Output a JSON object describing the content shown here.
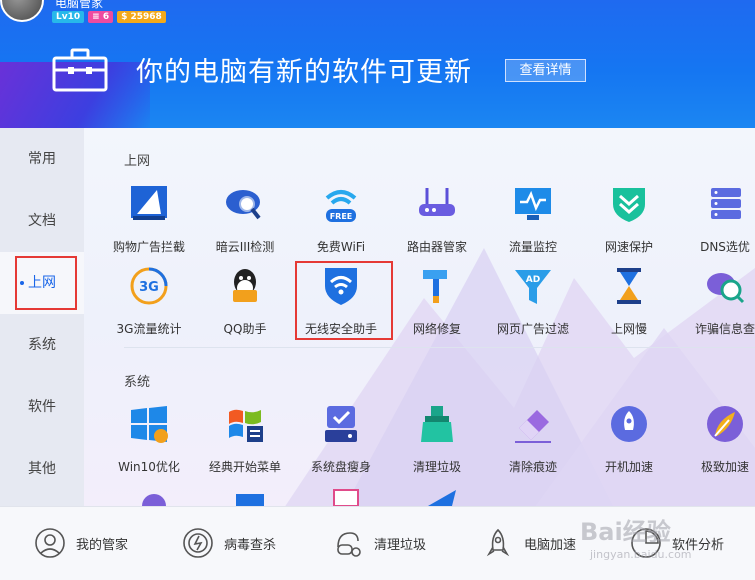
{
  "header": {
    "username": "电脑管家",
    "badges": {
      "level": "Lv10",
      "vip": "6",
      "coins": "25968"
    },
    "update_title": "你的电脑有新的软件可更新",
    "detail_button": "查看详情"
  },
  "sidebar": {
    "items": [
      {
        "label": "常用"
      },
      {
        "label": "文档"
      },
      {
        "label": "上网"
      },
      {
        "label": "系统"
      },
      {
        "label": "软件"
      },
      {
        "label": "其他"
      }
    ],
    "active": "上网"
  },
  "sections": {
    "internet": {
      "title": "上网",
      "row1": [
        {
          "label": "购物广告拦截",
          "icon": "ad-block-icon"
        },
        {
          "label": "暗云III检测",
          "icon": "cloud-scan-icon"
        },
        {
          "label": "免费WiFi",
          "icon": "free-wifi-icon",
          "icon_text": "FREE"
        },
        {
          "label": "路由器管家",
          "icon": "router-icon"
        },
        {
          "label": "流量监控",
          "icon": "traffic-monitor-icon"
        },
        {
          "label": "网速保护",
          "icon": "speed-protect-icon"
        },
        {
          "label": "DNS选优",
          "icon": "dns-icon"
        }
      ],
      "row2": [
        {
          "label": "3G流量统计",
          "icon": "3g-stat-icon",
          "icon_text": "3G"
        },
        {
          "label": "QQ助手",
          "icon": "qq-icon"
        },
        {
          "label": "无线安全助手",
          "icon": "wifi-shield-icon"
        },
        {
          "label": "网络修复",
          "icon": "hammer-icon"
        },
        {
          "label": "网页广告过滤",
          "icon": "ad-filter-icon",
          "icon_text": "AD"
        },
        {
          "label": "上网慢",
          "icon": "hourglass-icon"
        },
        {
          "label": "诈骗信息查",
          "icon": "fraud-search-icon"
        }
      ]
    },
    "system": {
      "title": "系统",
      "row1": [
        {
          "label": "Win10优化",
          "icon": "windows10-icon"
        },
        {
          "label": "经典开始菜单",
          "icon": "start-menu-icon"
        },
        {
          "label": "系统盘瘦身",
          "icon": "disk-slim-icon"
        },
        {
          "label": "清理垃圾",
          "icon": "broom-icon"
        },
        {
          "label": "清除痕迹",
          "icon": "eraser-icon"
        },
        {
          "label": "开机加速",
          "icon": "boot-rocket-icon"
        },
        {
          "label": "极致加速",
          "icon": "feather-pen-icon"
        }
      ]
    }
  },
  "bottom_bar": [
    {
      "label": "我的管家",
      "icon": "butler-icon"
    },
    {
      "label": "病毒查杀",
      "icon": "virus-scan-icon"
    },
    {
      "label": "清理垃圾",
      "icon": "vacuum-icon"
    },
    {
      "label": "电脑加速",
      "icon": "rocket-icon"
    },
    {
      "label": "软件分析",
      "icon": "software-analysis-icon"
    }
  ],
  "watermark": {
    "text": "Bai经验",
    "url": "jingyan.baidu.com"
  },
  "colors": {
    "header_blue": "#1f6af0",
    "accent": "#1a66e8",
    "highlight_red": "#e53935"
  }
}
